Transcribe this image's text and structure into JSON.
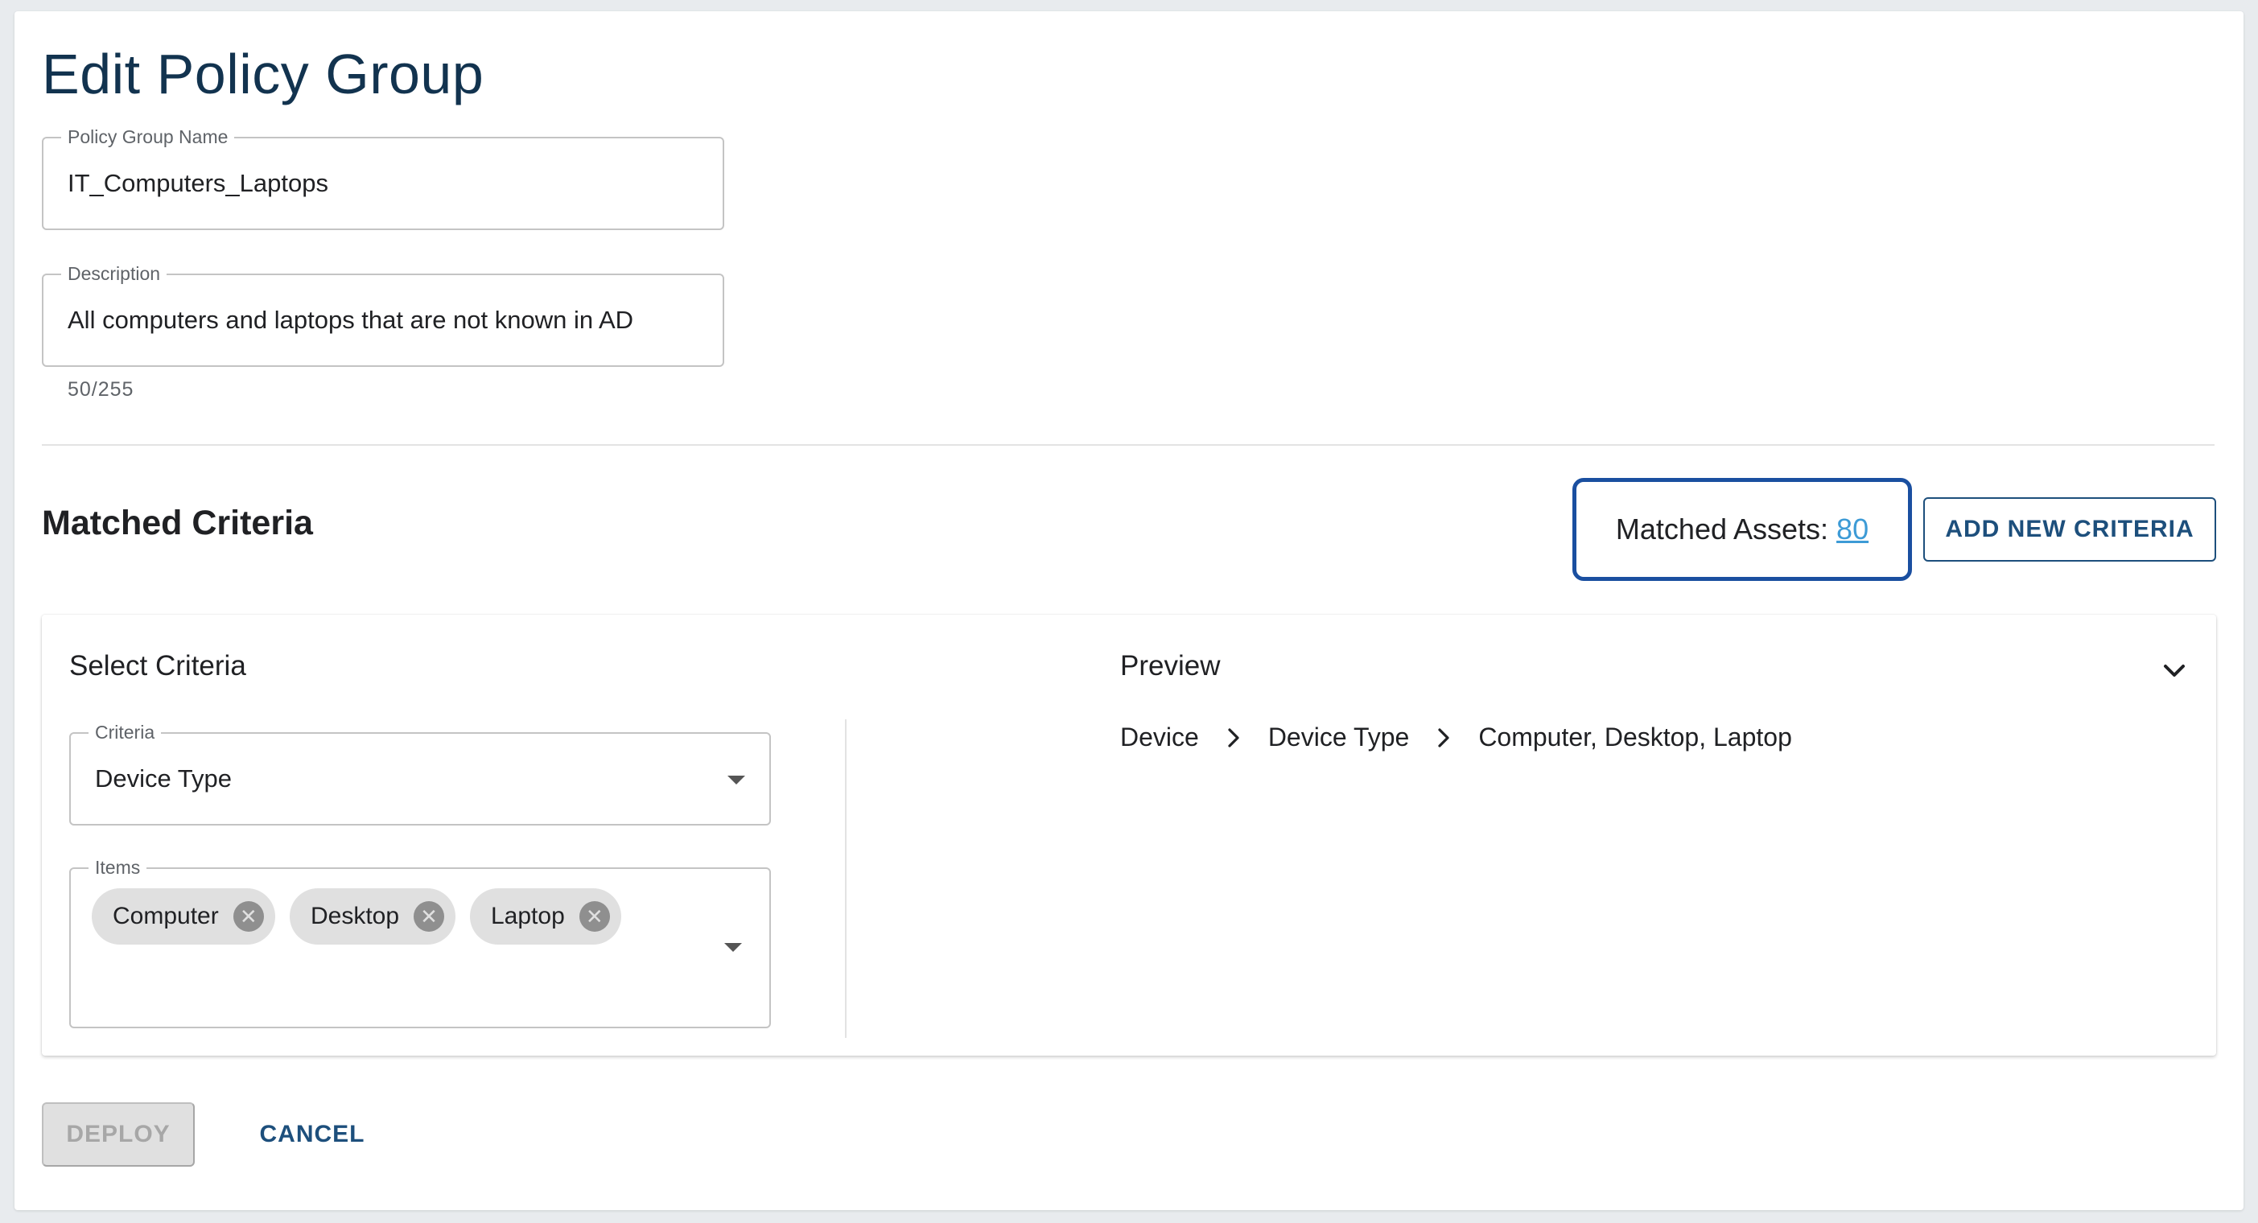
{
  "page": {
    "title": "Edit Policy Group"
  },
  "form": {
    "name": {
      "label": "Policy Group Name",
      "value": "IT_Computers_Laptops"
    },
    "description": {
      "label": "Description",
      "value": "All computers and laptops that are not known in AD",
      "counter": "50/255"
    }
  },
  "matched_criteria": {
    "title": "Matched Criteria",
    "matched_assets_label": "Matched Assets:",
    "matched_assets_count": "80",
    "add_button_label": "ADD NEW CRITERIA"
  },
  "criteria_card": {
    "select_title": "Select Criteria",
    "criteria": {
      "label": "Criteria",
      "value": "Device Type"
    },
    "items": {
      "label": "Items",
      "chips": [
        "Computer",
        "Desktop",
        "Laptop"
      ]
    },
    "preview": {
      "title": "Preview",
      "path": [
        "Device",
        "Device Type",
        "Computer, Desktop, Laptop"
      ]
    }
  },
  "actions": {
    "deploy_label": "DEPLOY",
    "cancel_label": "CANCEL"
  },
  "colors": {
    "title": "#12334f",
    "primary": "#1d4f7c",
    "highlight_border": "#1a4fa0",
    "link": "#3d9bd6",
    "chip_bg": "#e0e0e0",
    "disabled_bg": "#e0e0e0",
    "disabled_text": "#a7a7a7"
  }
}
